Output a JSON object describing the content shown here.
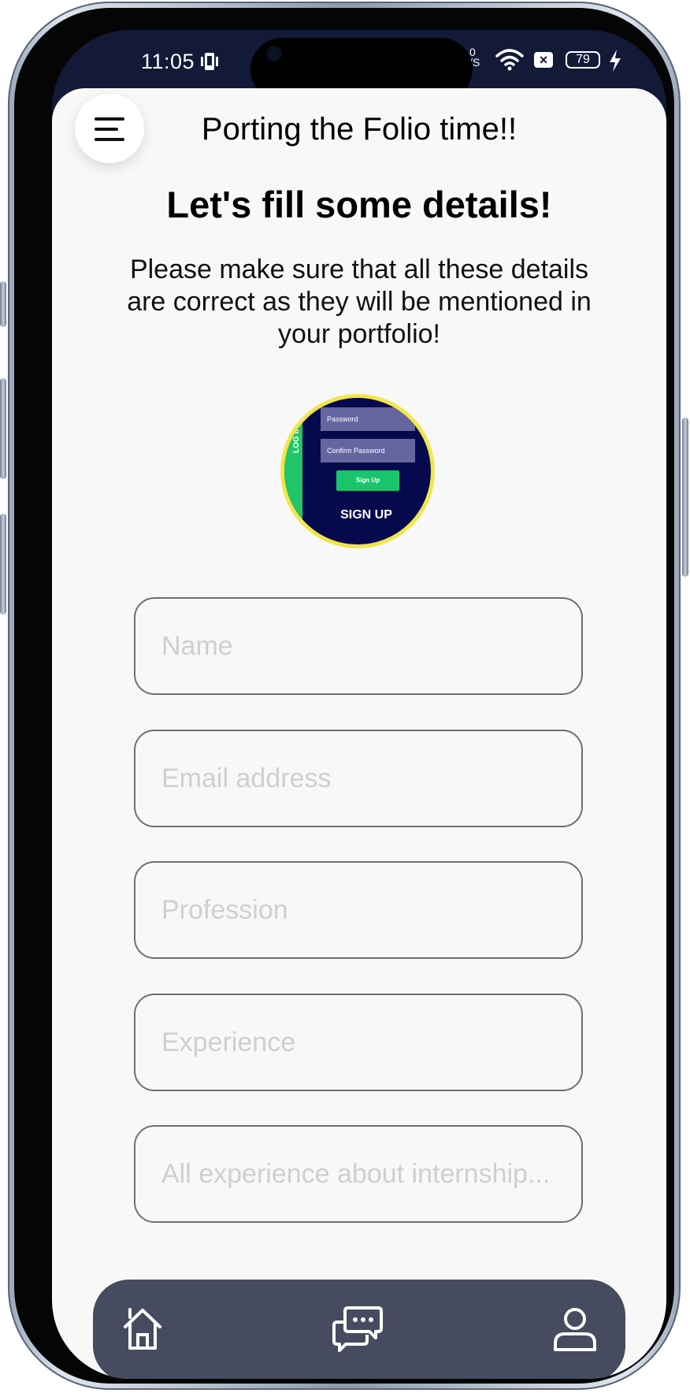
{
  "status_bar": {
    "time": "11:05",
    "battery": "79",
    "network_line1": "0",
    "network_line2": "/S"
  },
  "header": {
    "title": "Porting the Folio time!!"
  },
  "main": {
    "heading": "Let's fill some details!",
    "description": "Please make sure that all these details are correct as they will be mentioned in your portfolio!"
  },
  "preview_image": {
    "side_label": "LOG IN",
    "field1": "Password",
    "field2": "Confirm Password",
    "button": "Sign Up",
    "caption": "SIGN UP"
  },
  "form": {
    "name_placeholder": "Name",
    "email_placeholder": "Email address",
    "profession_placeholder": "Profession",
    "experience_placeholder": "Experience",
    "internship_placeholder": "All experience about internship..."
  },
  "bottom_nav": {
    "items": [
      {
        "icon": "home-icon"
      },
      {
        "icon": "chat-icon"
      },
      {
        "icon": "profile-icon"
      }
    ]
  },
  "colors": {
    "nav_background": "#464b5f",
    "avatar_ring": "#f1e64a",
    "app_background": "#f8f8f8"
  }
}
